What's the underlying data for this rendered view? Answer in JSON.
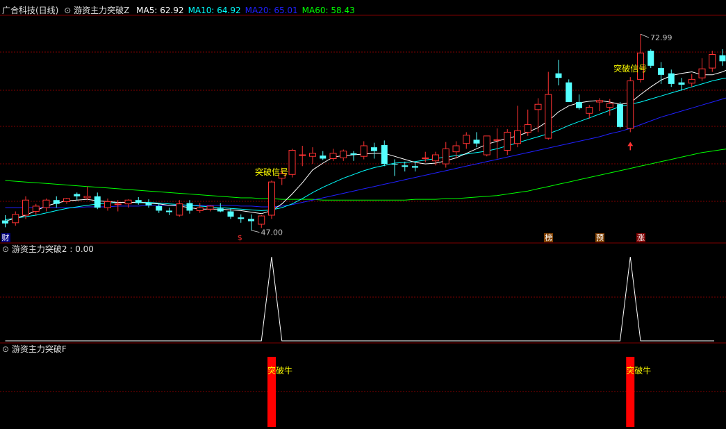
{
  "main_panel": {
    "stock_title": "广合科技(日线)",
    "indicator_name": "游资主力突破Z",
    "ma": [
      {
        "label": "MA5: 62.92",
        "color": "#ffffff"
      },
      {
        "label": "MA10: 64.92",
        "color": "#00ffff"
      },
      {
        "label": "MA20: 65.01",
        "color": "#2020ff"
      },
      {
        "label": "MA60: 58.43",
        "color": "#00ff00"
      }
    ],
    "high_label": "72.99",
    "low_label": "47.00",
    "signal_text": "突破信号",
    "event_markers": [
      {
        "text": "财",
        "bg": "#000080",
        "color": "#ffffff"
      },
      {
        "text": "$",
        "bg": "#000000",
        "color": "#ff3030"
      },
      {
        "text": "榜",
        "bg": "#804000",
        "color": "#ffffff"
      },
      {
        "text": "预",
        "bg": "#804000",
        "color": "#ffffff"
      },
      {
        "text": "涨",
        "bg": "#800000",
        "color": "#ffffff"
      }
    ]
  },
  "panel2": {
    "title": "游资主力突破2 : 0.00"
  },
  "panel3": {
    "title": "游资主力突破F",
    "bar_label": "突破牛"
  },
  "colors": {
    "up": "#ff3232",
    "down": "#54ffff",
    "ma5": "#ffffff",
    "ma10": "#00ffff",
    "ma20": "#2020ff",
    "ma60": "#00ff00",
    "grid": "#800000",
    "label_yellow": "#ffff00"
  },
  "chart_data": [
    {
      "type": "candlestick",
      "title": "广合科技(日线)",
      "ylim": [
        45.5,
        75.5
      ],
      "ohlc": [
        [
          48.3,
          49.0,
          47.4,
          47.9
        ],
        [
          48.0,
          49.5,
          47.6,
          49.1
        ],
        [
          49.0,
          51.5,
          48.5,
          51.0
        ],
        [
          49.5,
          50.5,
          49.0,
          50.2
        ],
        [
          50.0,
          51.2,
          49.5,
          51.0
        ],
        [
          51.0,
          51.5,
          50.0,
          50.5
        ],
        [
          50.8,
          51.3,
          50.5,
          51.2
        ],
        [
          51.8,
          52.0,
          51.0,
          51.5
        ],
        [
          51.3,
          52.8,
          51.0,
          51.5
        ],
        [
          51.5,
          52.0,
          49.8,
          50.0
        ],
        [
          50.0,
          51.2,
          49.6,
          50.8
        ],
        [
          50.5,
          51.0,
          49.5,
          50.5
        ],
        [
          50.5,
          51.1,
          50.0,
          51.0
        ],
        [
          51.0,
          51.4,
          50.4,
          50.6
        ],
        [
          50.6,
          51.1,
          50.0,
          50.3
        ],
        [
          50.2,
          50.6,
          49.3,
          49.6
        ],
        [
          49.6,
          50.0,
          49.0,
          49.4
        ],
        [
          49.0,
          51.0,
          48.8,
          50.5
        ],
        [
          50.6,
          51.0,
          49.2,
          49.6
        ],
        [
          49.6,
          50.6,
          49.3,
          50.0
        ],
        [
          49.8,
          50.3,
          49.5,
          50.2
        ],
        [
          49.9,
          50.6,
          49.4,
          49.5
        ],
        [
          49.5,
          49.9,
          48.5,
          48.8
        ],
        [
          48.7,
          49.1,
          48.0,
          48.5
        ],
        [
          48.5,
          49.1,
          47.0,
          48.2
        ],
        [
          47.8,
          49.0,
          47.3,
          48.9
        ],
        [
          49.0,
          53.6,
          48.5,
          53.4
        ],
        [
          53.9,
          55.3,
          53.0,
          54.5
        ],
        [
          54.4,
          57.8,
          54.0,
          57.6
        ],
        [
          57.0,
          58.2,
          55.5,
          57.0
        ],
        [
          56.8,
          58.0,
          55.8,
          57.2
        ],
        [
          56.9,
          57.5,
          56.3,
          56.5
        ],
        [
          56.5,
          57.8,
          56.2,
          57.2
        ],
        [
          56.6,
          57.7,
          56.2,
          57.5
        ],
        [
          57.2,
          57.5,
          56.2,
          57.0
        ],
        [
          56.8,
          58.8,
          56.4,
          58.2
        ],
        [
          58.0,
          58.6,
          56.5,
          57.5
        ],
        [
          58.3,
          58.9,
          55.5,
          55.8
        ],
        [
          55.8,
          56.4,
          54.2,
          55.7
        ],
        [
          55.6,
          56.1,
          54.8,
          55.4
        ],
        [
          55.5,
          56.0,
          54.8,
          55.3
        ],
        [
          56.5,
          57.4,
          56.0,
          56.6
        ],
        [
          56.2,
          57.4,
          55.6,
          57.0
        ],
        [
          55.8,
          58.7,
          55.3,
          57.8
        ],
        [
          57.4,
          58.8,
          56.5,
          58.2
        ],
        [
          58.5,
          60.0,
          57.8,
          59.6
        ],
        [
          59.0,
          60.0,
          58.0,
          58.5
        ],
        [
          57.0,
          59.5,
          56.8,
          59.5
        ],
        [
          59.0,
          60.5,
          56.5,
          59.0
        ],
        [
          57.6,
          60.4,
          57.0,
          60.0
        ],
        [
          58.5,
          63.5,
          58.0,
          60.2
        ],
        [
          60.0,
          63.0,
          59.5,
          61.0
        ],
        [
          63.0,
          64.5,
          60.0,
          63.7
        ],
        [
          59.2,
          68.0,
          59.0,
          65.0
        ],
        [
          67.8,
          69.6,
          66.2,
          67.2
        ],
        [
          66.6,
          67.0,
          64.0,
          64.0
        ],
        [
          64.0,
          65.0,
          63.0,
          63.2
        ],
        [
          62.5,
          63.6,
          61.8,
          63.3
        ],
        [
          64.0,
          64.5,
          62.8,
          64.2
        ],
        [
          63.3,
          64.4,
          62.2,
          63.8
        ],
        [
          63.7,
          64.0,
          60.5,
          60.7
        ],
        [
          60.5,
          67.3,
          60.0,
          66.8
        ],
        [
          67.0,
          73.0,
          66.6,
          70.5
        ],
        [
          70.8,
          71.0,
          68.5,
          68.8
        ],
        [
          68.5,
          69.3,
          66.4,
          67.6
        ],
        [
          67.8,
          68.3,
          66.0,
          66.4
        ],
        [
          66.6,
          67.2,
          65.5,
          66.3
        ],
        [
          66.5,
          67.7,
          66.0,
          67.0
        ],
        [
          67.2,
          69.8,
          66.8,
          68.4
        ],
        [
          68.5,
          70.8,
          68.0,
          70.3
        ],
        [
          70.2,
          71.0,
          68.8,
          69.4
        ],
        [
          69.7,
          71.5,
          67.4,
          68.2
        ],
        [
          67.6,
          68.4,
          65.4,
          66.6
        ],
        [
          66.5,
          67.0,
          64.8,
          65.6
        ],
        [
          65.5,
          67.0,
          64.8,
          66.4
        ],
        [
          66.0,
          66.9,
          65.4,
          65.9
        ],
        [
          65.5,
          66.7,
          64.2,
          64.5
        ],
        [
          64.5,
          65.2,
          64.0,
          64.5
        ]
      ],
      "ma5": [
        48.2,
        48.6,
        49.0,
        49.6,
        50.2,
        50.6,
        50.9,
        51.0,
        51.1,
        50.9,
        50.8,
        50.7,
        50.7,
        50.7,
        50.6,
        50.5,
        50.3,
        50.2,
        50.0,
        49.8,
        49.8,
        49.8,
        49.7,
        49.6,
        49.4,
        49.2,
        49.6,
        50.5,
        51.8,
        53.3,
        55.0,
        55.9,
        56.7,
        56.9,
        57.0,
        57.1,
        57.2,
        57.2,
        56.8,
        56.4,
        56.0,
        55.8,
        55.9,
        56.2,
        56.6,
        57.2,
        57.8,
        58.4,
        58.8,
        59.2,
        59.5,
        60.0,
        60.6,
        61.5,
        62.7,
        63.5,
        63.9,
        64.1,
        64.2,
        64.0,
        63.7,
        63.9,
        65.0,
        66.0,
        66.9,
        67.5,
        67.8,
        68.0,
        67.6,
        67.6,
        68.0,
        68.6,
        68.6,
        68.2,
        67.8,
        67.2,
        66.5,
        65.8
      ],
      "ma10": [
        48.4,
        48.6,
        48.8,
        49.0,
        49.3,
        49.6,
        49.9,
        50.1,
        50.3,
        50.5,
        50.6,
        50.7,
        50.7,
        50.7,
        50.7,
        50.6,
        50.5,
        50.4,
        50.3,
        50.2,
        50.1,
        50.0,
        49.9,
        49.8,
        49.7,
        49.6,
        49.7,
        50.0,
        50.5,
        51.2,
        52.0,
        52.7,
        53.3,
        53.9,
        54.4,
        54.9,
        55.3,
        55.6,
        55.9,
        56.0,
        56.1,
        56.3,
        56.5,
        56.7,
        56.9,
        57.1,
        57.3,
        57.5,
        57.8,
        58.2,
        58.6,
        59.0,
        59.4,
        59.8,
        60.3,
        60.9,
        61.4,
        61.9,
        62.4,
        62.9,
        63.4,
        63.7,
        64.0,
        64.4,
        64.8,
        65.2,
        65.6,
        66.0,
        66.4,
        66.8,
        67.1,
        67.3,
        67.4,
        67.4,
        67.3,
        67.2,
        67.0,
        66.7
      ],
      "ma20": [
        50.0,
        50.0,
        50.0,
        50.0,
        50.0,
        50.0,
        50.0,
        50.0,
        50.1,
        50.1,
        50.1,
        50.2,
        50.2,
        50.2,
        50.3,
        50.3,
        50.3,
        50.3,
        50.3,
        50.3,
        50.3,
        50.3,
        50.3,
        50.2,
        50.2,
        50.1,
        50.1,
        50.2,
        50.4,
        50.7,
        51.0,
        51.3,
        51.6,
        51.9,
        52.2,
        52.5,
        52.8,
        53.1,
        53.4,
        53.7,
        54.0,
        54.3,
        54.6,
        54.9,
        55.2,
        55.5,
        55.8,
        56.1,
        56.4,
        56.7,
        57.0,
        57.3,
        57.6,
        57.9,
        58.2,
        58.5,
        58.8,
        59.1,
        59.4,
        59.8,
        60.1,
        60.5,
        61.0,
        61.5,
        62.0,
        62.4,
        62.8,
        63.2,
        63.6,
        64.0,
        64.4,
        64.8,
        65.1,
        65.3,
        65.4,
        65.3,
        65.2,
        65.0
      ],
      "ma60": [
        53.6,
        53.5,
        53.4,
        53.3,
        53.2,
        53.1,
        53.0,
        52.9,
        52.8,
        52.7,
        52.6,
        52.5,
        52.4,
        52.3,
        52.2,
        52.1,
        52.0,
        51.9,
        51.8,
        51.7,
        51.6,
        51.5,
        51.4,
        51.3,
        51.3,
        51.2,
        51.2,
        51.1,
        51.1,
        51.1,
        51.1,
        51.0,
        51.0,
        51.0,
        51.0,
        51.0,
        51.0,
        51.0,
        51.0,
        51.0,
        51.1,
        51.1,
        51.1,
        51.2,
        51.2,
        51.3,
        51.4,
        51.5,
        51.6,
        51.8,
        52.0,
        52.2,
        52.5,
        52.8,
        53.1,
        53.4,
        53.7,
        54.0,
        54.3,
        54.6,
        54.9,
        55.2,
        55.5,
        55.8,
        56.1,
        56.4,
        56.7,
        57.0,
        57.3,
        57.5,
        57.7,
        57.9,
        58.1,
        58.3,
        58.5,
        58.7,
        58.9,
        59.1
      ],
      "high_marker": {
        "label": "72.99",
        "index": 62
      },
      "low_marker": {
        "label": "47.00",
        "index": 24
      },
      "signals": [
        {
          "label": "突破信号",
          "index": 26
        },
        {
          "label": "突破信号",
          "index": 61
        }
      ],
      "up_arrow_index": 61,
      "event_marker_indices": [
        0,
        23,
        53,
        58,
        62
      ]
    },
    {
      "type": "line",
      "title": "游资主力突破2 : 0.00",
      "ylim": [
        0,
        1.3
      ],
      "spikes_at": [
        26,
        61
      ],
      "baseline": 0
    },
    {
      "type": "bar",
      "title": "游资主力突破F",
      "bars_at": [
        26,
        61
      ],
      "values": [
        1,
        1
      ],
      "bar_label": "突破牛"
    }
  ]
}
